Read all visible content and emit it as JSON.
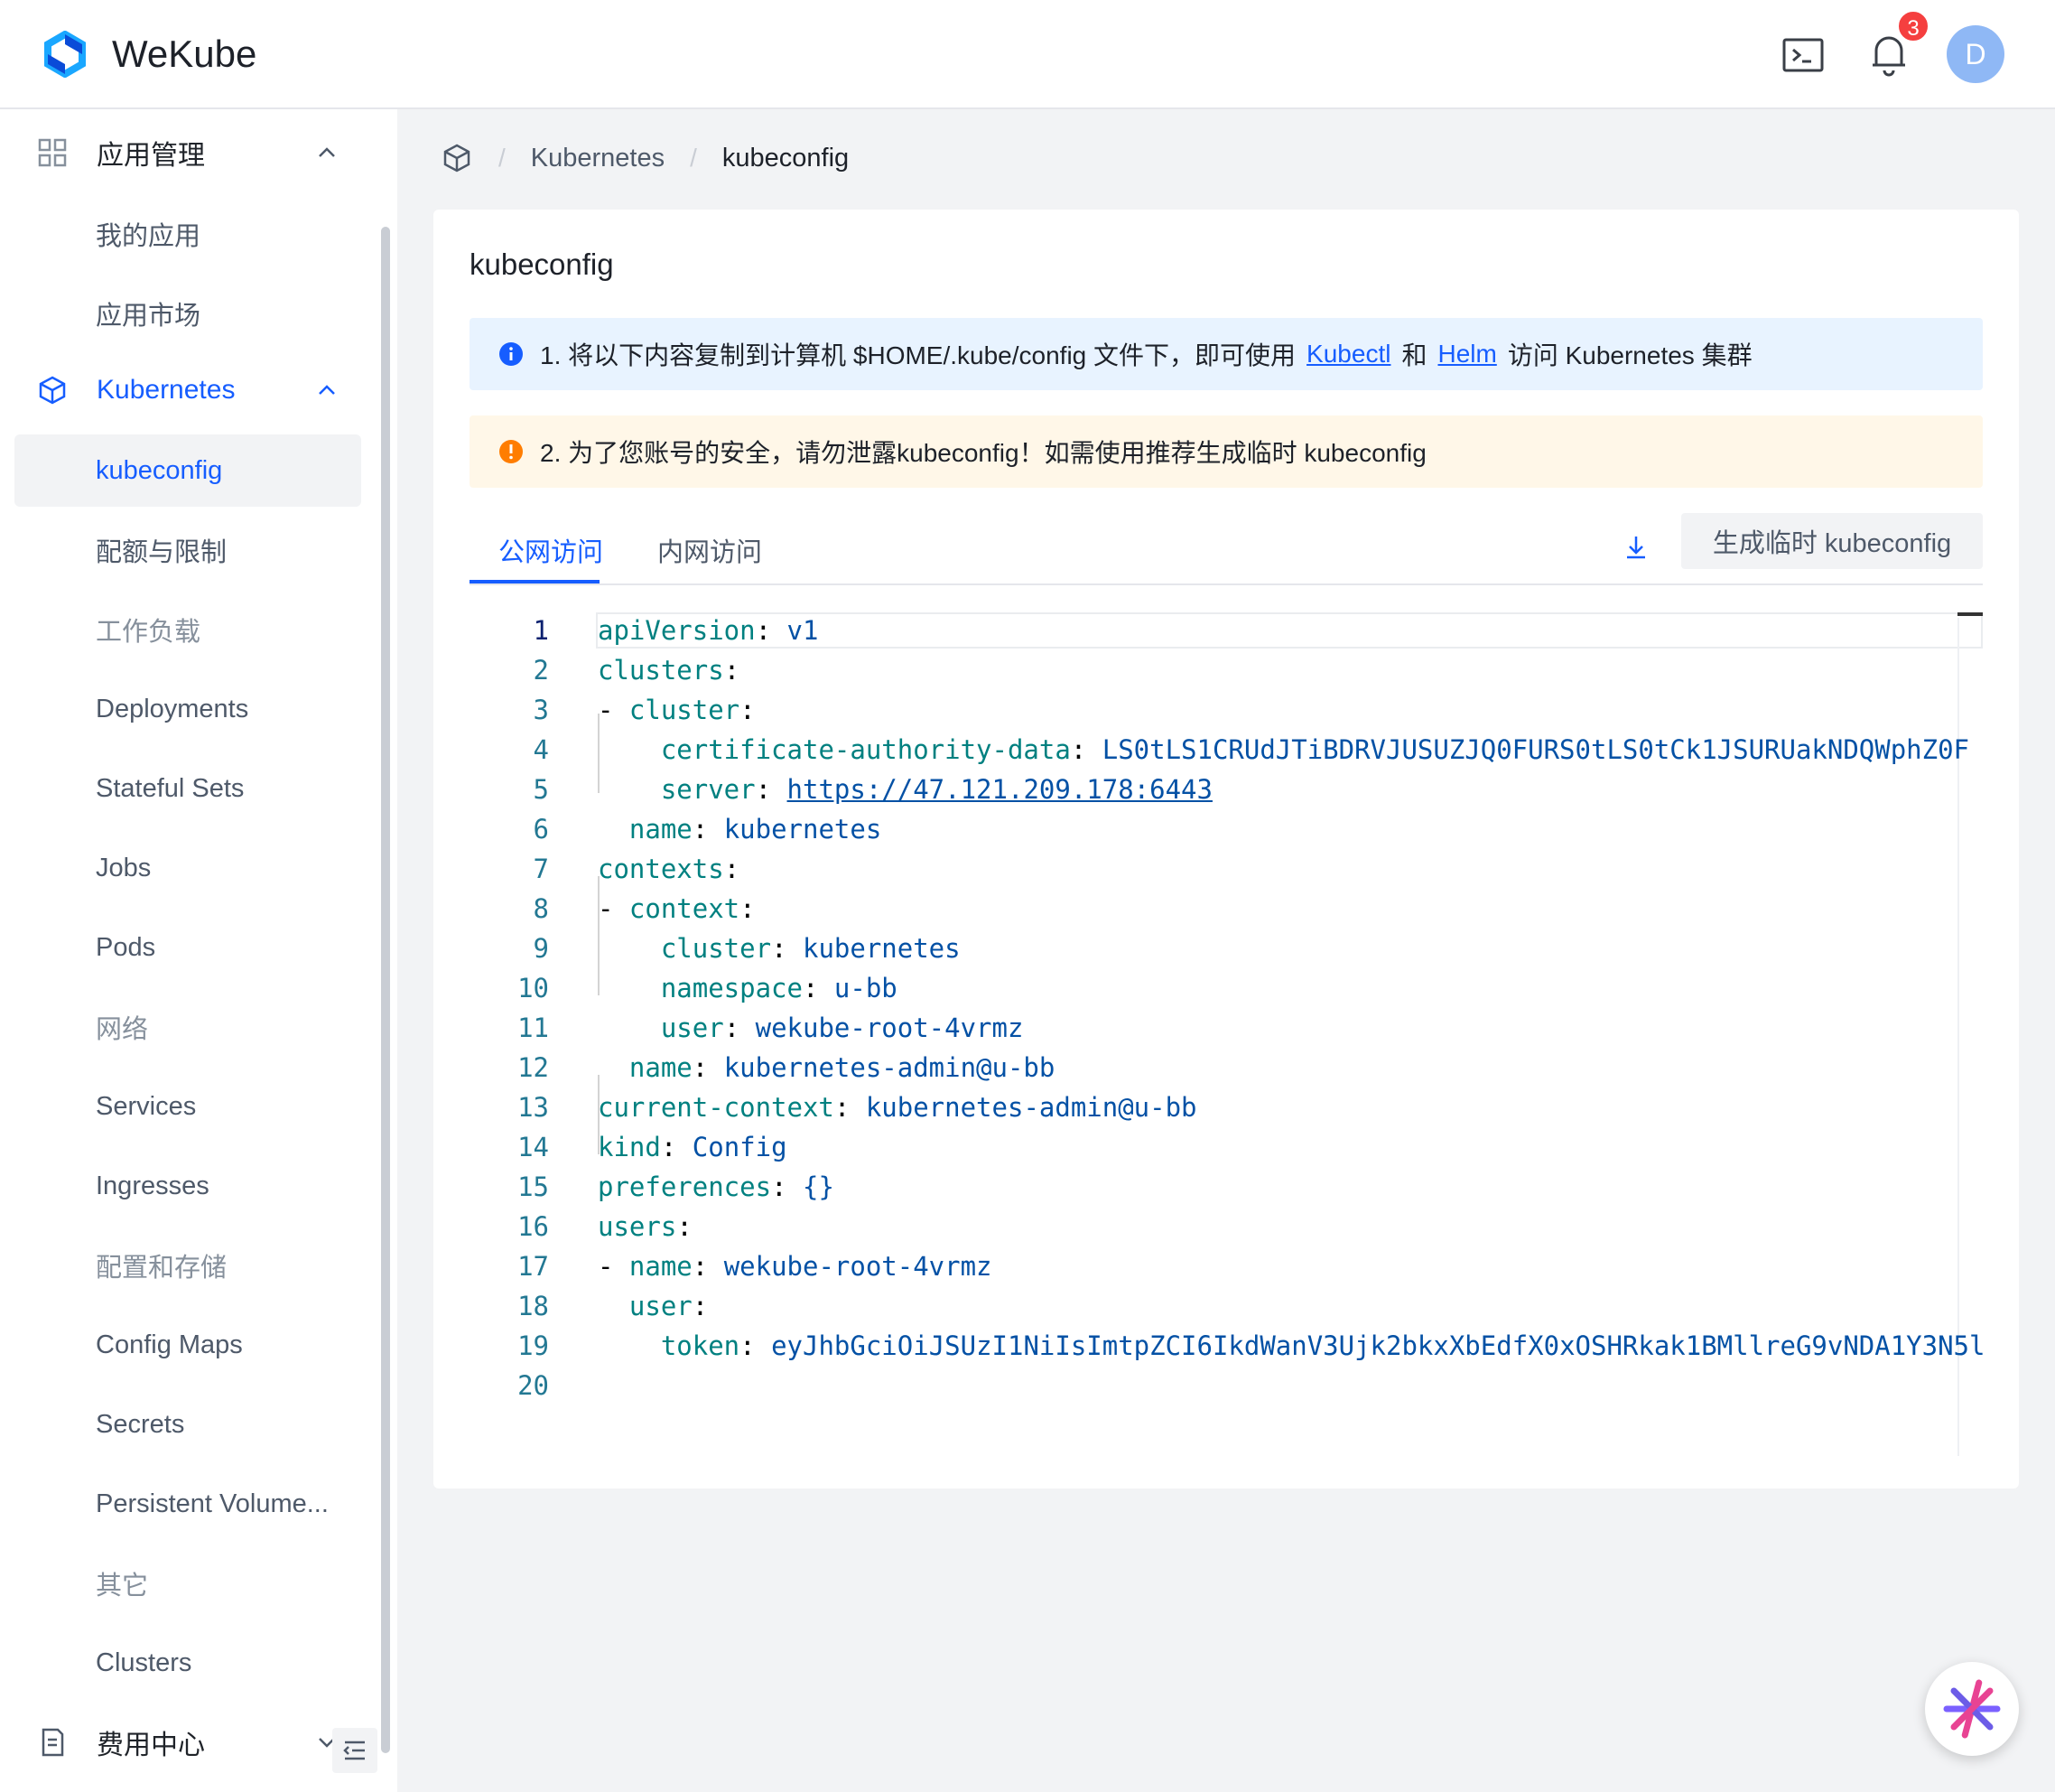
{
  "app": {
    "title": "WeKube"
  },
  "header": {
    "notification_count": "3",
    "avatar_initial": "D",
    "icons": [
      "terminal-icon",
      "bell-icon"
    ]
  },
  "sidebar": {
    "app_mgmt": {
      "label": "应用管理",
      "items": [
        "我的应用",
        "应用市场"
      ]
    },
    "kubernetes": {
      "label": "Kubernetes",
      "items": [
        "kubeconfig",
        "配额与限制",
        "工作负载",
        "Deployments",
        "Stateful Sets",
        "Jobs",
        "Pods",
        "网络",
        "Services",
        "Ingresses",
        "配置和存储",
        "Config Maps",
        "Secrets",
        "Persistent Volume...",
        "其它",
        "Clusters"
      ]
    },
    "billing": {
      "label": "费用中心"
    }
  },
  "breadcrumb": {
    "items": [
      "Kubernetes",
      "kubeconfig"
    ]
  },
  "card": {
    "title": "kubeconfig",
    "info_alert": {
      "pre": "1. 将以下内容复制到计算机 $HOME/.kube/config 文件下，即可使用",
      "link1": "Kubectl",
      "mid": "和",
      "link2": "Helm",
      "post": "访问 Kubernetes 集群"
    },
    "warn_alert": {
      "text": "2. 为了您账号的安全，请勿泄露kubeconfig！如需使用推荐生成临时 kubeconfig"
    },
    "tabs": [
      "公网访问",
      "内网访问"
    ],
    "generate_button": "生成临时 kubeconfig"
  },
  "code": {
    "lines": [
      {
        "n": "1",
        "indent": "",
        "dash": "",
        "key": "apiVersion",
        "val": "v1"
      },
      {
        "n": "2",
        "indent": "",
        "dash": "",
        "key": "clusters",
        "val": ""
      },
      {
        "n": "3",
        "indent": "",
        "dash": "- ",
        "key": "cluster",
        "val": ""
      },
      {
        "n": "4",
        "indent": "    ",
        "dash": "",
        "key": "certificate-authority-data",
        "val": "LS0tLS1CRUdJTiBDRVJUSUZJQ0FURS0tLS0tCk1JSURUakNDQWphZ0F"
      },
      {
        "n": "5",
        "indent": "    ",
        "dash": "",
        "key": "server",
        "val": "https://47.121.209.178:6443",
        "link": true
      },
      {
        "n": "6",
        "indent": "  ",
        "dash": "",
        "key": "name",
        "val": "kubernetes"
      },
      {
        "n": "7",
        "indent": "",
        "dash": "",
        "key": "contexts",
        "val": ""
      },
      {
        "n": "8",
        "indent": "",
        "dash": "- ",
        "key": "context",
        "val": ""
      },
      {
        "n": "9",
        "indent": "    ",
        "dash": "",
        "key": "cluster",
        "val": "kubernetes"
      },
      {
        "n": "10",
        "indent": "    ",
        "dash": "",
        "key": "namespace",
        "val": "u-bb"
      },
      {
        "n": "11",
        "indent": "    ",
        "dash": "",
        "key": "user",
        "val": "wekube-root-4vrmz"
      },
      {
        "n": "12",
        "indent": "  ",
        "dash": "",
        "key": "name",
        "val": "kubernetes-admin@u-bb"
      },
      {
        "n": "13",
        "indent": "",
        "dash": "",
        "key": "current-context",
        "val": "kubernetes-admin@u-bb"
      },
      {
        "n": "14",
        "indent": "",
        "dash": "",
        "key": "kind",
        "val": "Config"
      },
      {
        "n": "15",
        "indent": "",
        "dash": "",
        "key": "preferences",
        "val": "{}"
      },
      {
        "n": "16",
        "indent": "",
        "dash": "",
        "key": "users",
        "val": ""
      },
      {
        "n": "17",
        "indent": "",
        "dash": "- ",
        "key": "name",
        "val": "wekube-root-4vrmz"
      },
      {
        "n": "18",
        "indent": "  ",
        "dash": "",
        "key": "user",
        "val": ""
      },
      {
        "n": "19",
        "indent": "    ",
        "dash": "",
        "key": "token",
        "val": "eyJhbGciOiJSUzI1NiIsImtpZCI6IkdWanV3Ujk2bkxXbEdfX0xOSHRkak1BMllreG9vNDA1Y3N5l"
      },
      {
        "n": "20",
        "indent": "",
        "dash": "",
        "key": "",
        "val": ""
      }
    ]
  },
  "colors": {
    "accent": "#165dff",
    "info_bg": "#e8f3ff",
    "warn_bg": "#fff7e8",
    "badge": "#f53f3f",
    "avatar": "#8fb8f5"
  }
}
